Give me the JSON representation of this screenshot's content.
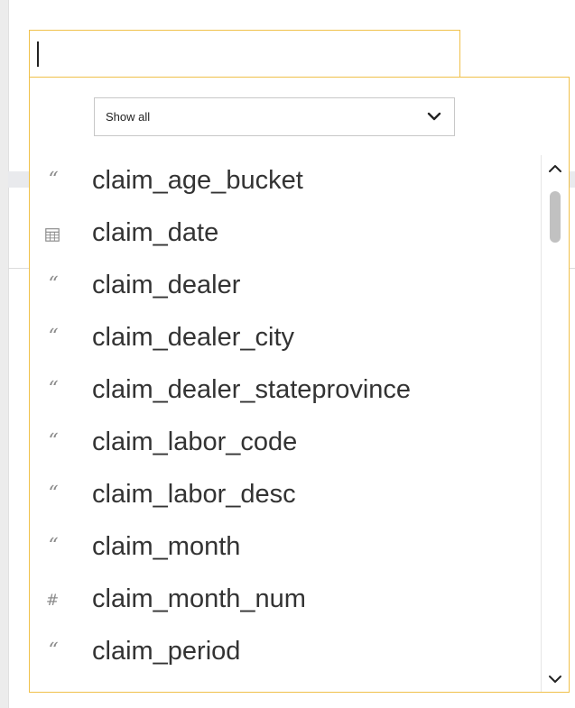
{
  "search": {
    "value": "",
    "placeholder": ""
  },
  "filter": {
    "selected": "Show all"
  },
  "fields": [
    {
      "type_icon": "text-icon",
      "glyph": "“",
      "name": "claim_age_bucket"
    },
    {
      "type_icon": "calendar-icon",
      "glyph": "",
      "name": "claim_date"
    },
    {
      "type_icon": "text-icon",
      "glyph": "“",
      "name": "claim_dealer"
    },
    {
      "type_icon": "text-icon",
      "glyph": "“",
      "name": "claim_dealer_city"
    },
    {
      "type_icon": "text-icon",
      "glyph": "“",
      "name": "claim_dealer_stateprovince"
    },
    {
      "type_icon": "text-icon",
      "glyph": "“",
      "name": "claim_labor_code"
    },
    {
      "type_icon": "text-icon",
      "glyph": "“",
      "name": "claim_labor_desc"
    },
    {
      "type_icon": "text-icon",
      "glyph": "“",
      "name": "claim_month"
    },
    {
      "type_icon": "number-icon",
      "glyph": "#",
      "name": "claim_month_num"
    },
    {
      "type_icon": "text-icon",
      "glyph": "“",
      "name": "claim_period"
    }
  ],
  "colors": {
    "accent_border": "#f0c14b",
    "icon": "#8a8a8a",
    "text": "#333333"
  }
}
